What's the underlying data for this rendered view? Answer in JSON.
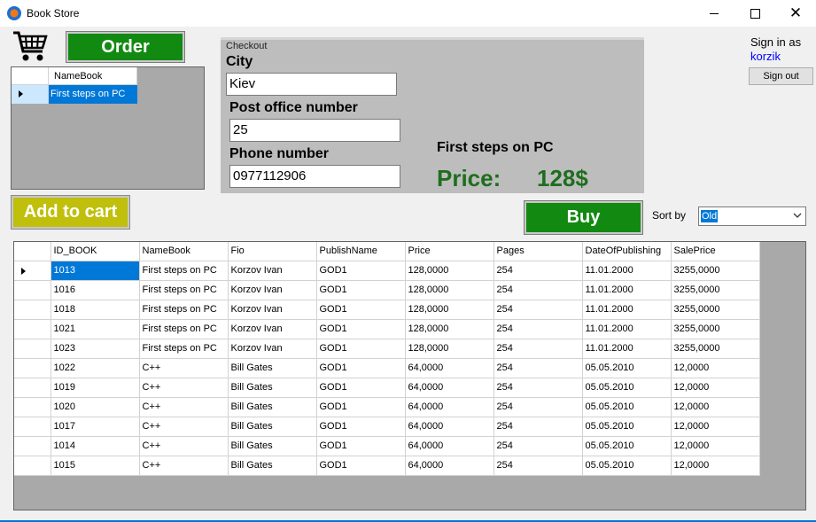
{
  "window": {
    "title": "Book Store"
  },
  "cart": {
    "column": "NameBook",
    "items": [
      "First steps on PC"
    ]
  },
  "buttons": {
    "order": "Order",
    "add_to_cart": "Add to cart",
    "buy": "Buy",
    "sign_out": "Sign out"
  },
  "checkout": {
    "legend": "Checkout",
    "city_label": "City",
    "city_value": "Kiev",
    "post_label": "Post office number",
    "post_value": "25",
    "phone_label": "Phone number",
    "phone_value": "0977112906",
    "book_title": "First steps on PC",
    "price_label": "Price:",
    "price_value": "128$"
  },
  "account": {
    "sign_in_label": "Sign in as",
    "username": "korzik"
  },
  "sort": {
    "label": "Sort by",
    "selected": "Old"
  },
  "books": {
    "columns": [
      "ID_BOOK",
      "NameBook",
      "Fio",
      "PublishName",
      "Price",
      "Pages",
      "DateOfPublishing",
      "SalePrice"
    ],
    "rows": [
      [
        "1013",
        "First steps on PC",
        "Korzov Ivan",
        "GOD1",
        "128,0000",
        "254",
        "11.01.2000",
        "3255,0000"
      ],
      [
        "1016",
        "First steps on PC",
        "Korzov Ivan",
        "GOD1",
        "128,0000",
        "254",
        "11.01.2000",
        "3255,0000"
      ],
      [
        "1018",
        "First steps on PC",
        "Korzov Ivan",
        "GOD1",
        "128,0000",
        "254",
        "11.01.2000",
        "3255,0000"
      ],
      [
        "1021",
        "First steps on PC",
        "Korzov Ivan",
        "GOD1",
        "128,0000",
        "254",
        "11.01.2000",
        "3255,0000"
      ],
      [
        "1023",
        "First steps on PC",
        "Korzov Ivan",
        "GOD1",
        "128,0000",
        "254",
        "11.01.2000",
        "3255,0000"
      ],
      [
        "1022",
        "C++",
        "Bill Gates",
        "GOD1",
        "64,0000",
        "254",
        "05.05.2010",
        "12,0000"
      ],
      [
        "1019",
        "C++",
        "Bill Gates",
        "GOD1",
        "64,0000",
        "254",
        "05.05.2010",
        "12,0000"
      ],
      [
        "1020",
        "C++",
        "Bill Gates",
        "GOD1",
        "64,0000",
        "254",
        "05.05.2010",
        "12,0000"
      ],
      [
        "1017",
        "C++",
        "Bill Gates",
        "GOD1",
        "64,0000",
        "254",
        "05.05.2010",
        "12,0000"
      ],
      [
        "1014",
        "C++",
        "Bill Gates",
        "GOD1",
        "64,0000",
        "254",
        "05.05.2010",
        "12,0000"
      ],
      [
        "1015",
        "C++",
        "Bill Gates",
        "GOD1",
        "64,0000",
        "254",
        "05.05.2010",
        "12,0000"
      ]
    ]
  },
  "colors": {
    "order_green": "#128a12",
    "add_yellow": "#bfbf0c",
    "price_green": "#1e6e1e",
    "selection_blue": "#0078d7"
  }
}
